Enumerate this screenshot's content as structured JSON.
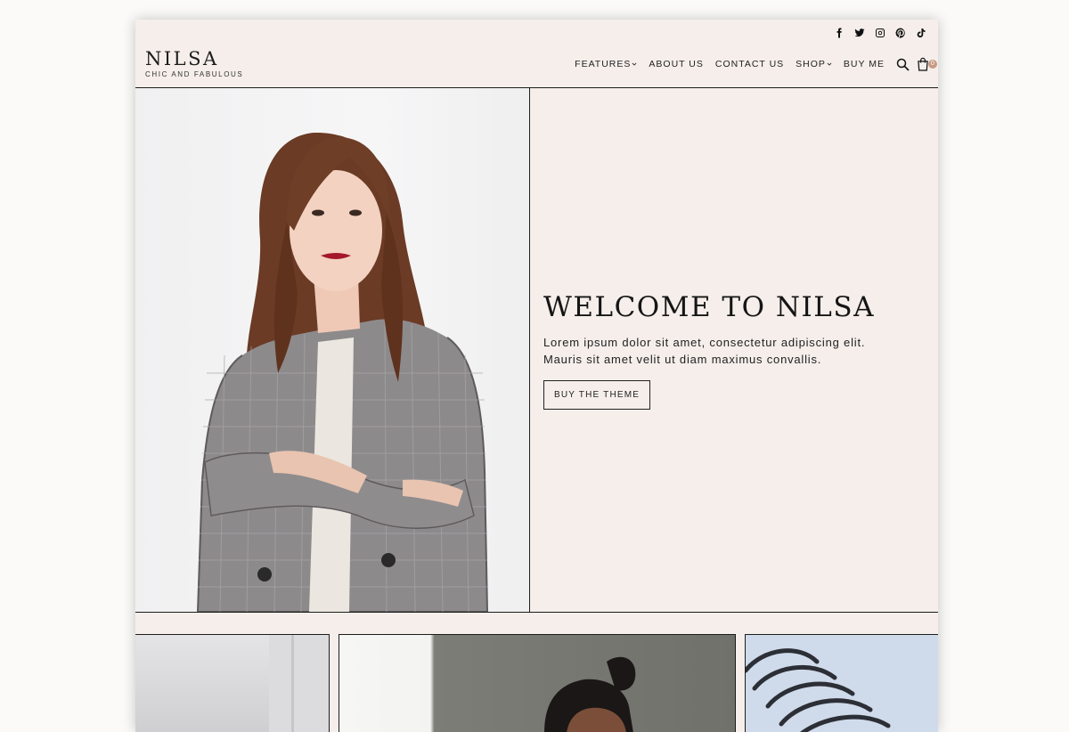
{
  "social": {
    "icons": [
      "facebook-icon",
      "twitter-icon",
      "instagram-icon",
      "pinterest-icon",
      "tiktok-icon"
    ]
  },
  "brand": {
    "name": "NILSA",
    "tagline": "CHIC AND FABULOUS"
  },
  "nav": {
    "features": "FEATURES",
    "about": "ABOUT US",
    "contact": "CONTACT US",
    "shop": "SHOP",
    "buy": "BUY ME",
    "cart_count": "0"
  },
  "hero": {
    "title": "WELCOME TO NILSA",
    "body_line1": "Lorem ipsum dolor sit amet, consectetur adipiscing elit.",
    "body_line2": "Mauris sit amet velit ut diam maximus convallis.",
    "button": "BUY THE THEME"
  },
  "colors": {
    "background": "#f5eeea",
    "accent": "#c79b86",
    "text": "#1d1d1d"
  }
}
